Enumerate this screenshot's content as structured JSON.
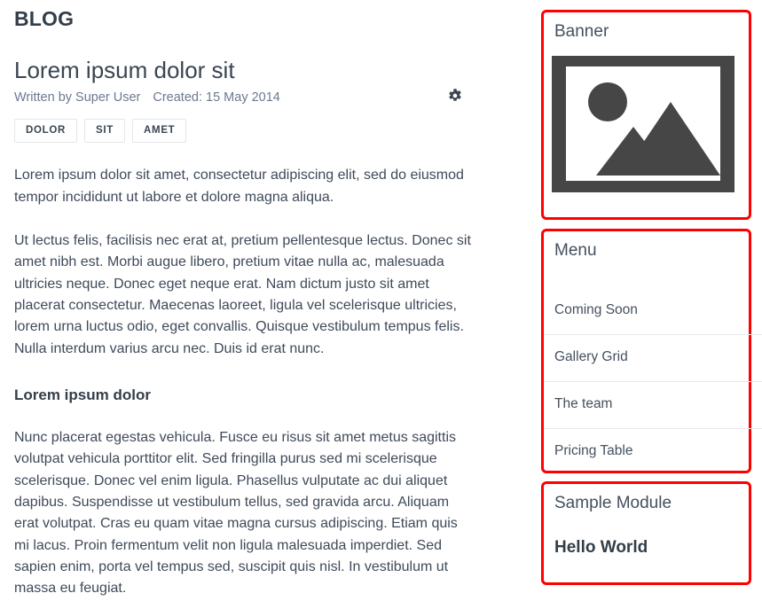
{
  "page": {
    "site_section_title": "BLOG"
  },
  "article": {
    "title": "Lorem ipsum dolor sit",
    "author_line": "Written by Super User",
    "created_line": "Created: 15 May 2014",
    "settings_icon": "gear-icon",
    "tags": [
      "DOLOR",
      "SIT",
      "AMET"
    ],
    "paragraphs": [
      "Lorem ipsum dolor sit amet, consectetur adipiscing elit, sed do eiusmod tempor incididunt ut labore et dolore magna aliqua.",
      "Ut lectus felis, facilisis nec erat at, pretium pellentesque lectus. Donec sit amet nibh est. Morbi augue libero, pretium vitae nulla ac, malesuada ultricies neque. Donec eget neque erat. Nam dictum justo sit amet placerat consectetur. Maecenas laoreet, ligula vel scelerisque ultricies, lorem urna luctus odio, eget convallis. Quisque vestibulum tempus felis. Nulla interdum varius arcu nec. Duis id erat nunc."
    ],
    "subheading": "Lorem ipsum dolor",
    "paragraph_after_subheading": "Nunc placerat egestas vehicula. Fusce eu risus sit amet metus sagittis volutpat vehicula porttitor elit. Sed fringilla purus sed mi scelerisque scelerisque. Donec vel enim ligula. Phasellus vulputate ac dui aliquet dapibus. Suspendisse ut vestibulum tellus, sed gravida arcu. Aliquam erat volutpat. Cras eu quam vitae magna cursus adipiscing. Etiam quis mi lacus. Proin fermentum velit non ligula malesuada imperdiet. Sed sapien enim, porta vel tempus sed, suscipit quis nisl. In vestibulum ut massa eu feugiat."
  },
  "sidebar": {
    "banner": {
      "title": "Banner",
      "image_icon": "image-placeholder-icon"
    },
    "menu": {
      "title": "Menu",
      "items": [
        {
          "label": "Coming Soon"
        },
        {
          "label": "Gallery Grid"
        },
        {
          "label": "The team"
        },
        {
          "label": "Pricing Table"
        }
      ]
    },
    "sample_module": {
      "title": "Sample Module",
      "body_text": "Hello World"
    }
  },
  "highlight": {
    "color": "#ff0000",
    "targets": [
      "banner-module",
      "menu-module",
      "sample-module"
    ]
  }
}
